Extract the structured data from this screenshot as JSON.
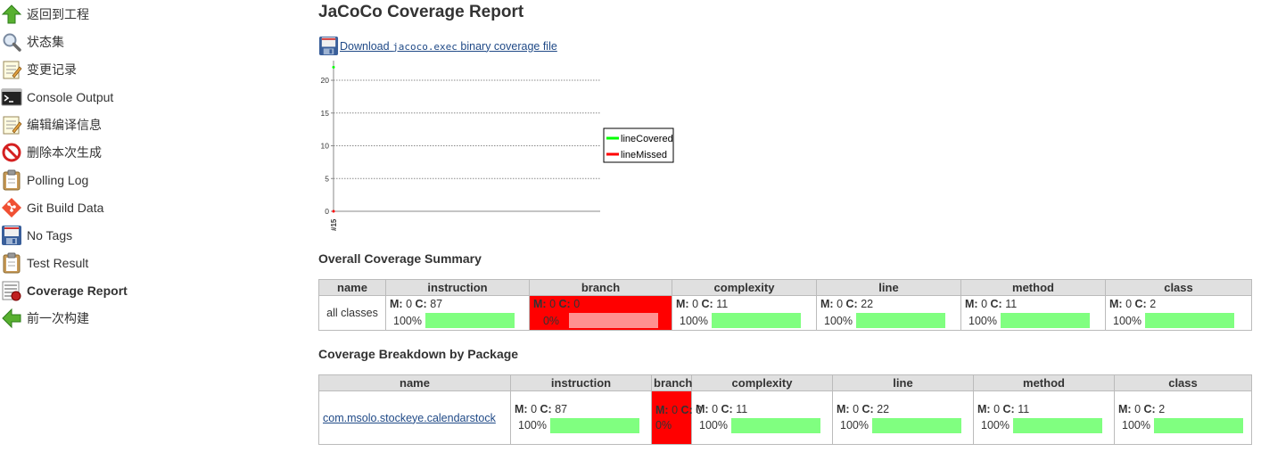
{
  "sidebar": {
    "items": [
      {
        "label": "返回到工程",
        "icon": "up-arrow-icon"
      },
      {
        "label": "状态集",
        "icon": "search-icon"
      },
      {
        "label": "变更记录",
        "icon": "notepad-icon"
      },
      {
        "label": "Console Output",
        "icon": "terminal-icon"
      },
      {
        "label": "编辑编译信息",
        "icon": "notepad-icon"
      },
      {
        "label": "删除本次生成",
        "icon": "no-entry-icon"
      },
      {
        "label": "Polling Log",
        "icon": "clipboard-icon"
      },
      {
        "label": "Git Build Data",
        "icon": "git-icon"
      },
      {
        "label": "No Tags",
        "icon": "floppy-icon"
      },
      {
        "label": "Test Result",
        "icon": "clipboard-icon"
      },
      {
        "label": "Coverage Report",
        "icon": "coverage-report-icon"
      },
      {
        "label": "前一次构建",
        "icon": "left-arrow-icon"
      }
    ],
    "active_index": 10
  },
  "main": {
    "title": "JaCoCo Coverage Report",
    "download": {
      "prefix": "Download ",
      "code": "jacoco.exec",
      "suffix": " binary coverage file"
    }
  },
  "chart_data": {
    "type": "line",
    "x": [
      "#15"
    ],
    "series": [
      {
        "name": "lineCovered",
        "color": "#00ff00",
        "values": [
          22
        ]
      },
      {
        "name": "lineMissed",
        "color": "#ff0000",
        "values": [
          0
        ]
      }
    ],
    "yticks": [
      0,
      5,
      10,
      15,
      20
    ],
    "ylim": [
      0,
      23
    ],
    "grid": true,
    "legend": "right"
  },
  "summary": {
    "title": "Overall Coverage Summary",
    "headers": [
      "name",
      "instruction",
      "branch",
      "complexity",
      "line",
      "method",
      "class"
    ],
    "row": {
      "name": "all classes",
      "cells": [
        {
          "m": "0",
          "c": "87",
          "pct": "100%",
          "ratio": 1
        },
        {
          "m": "0",
          "c": "0",
          "pct": "0%",
          "ratio": 0
        },
        {
          "m": "0",
          "c": "11",
          "pct": "100%",
          "ratio": 1
        },
        {
          "m": "0",
          "c": "22",
          "pct": "100%",
          "ratio": 1
        },
        {
          "m": "0",
          "c": "11",
          "pct": "100%",
          "ratio": 1
        },
        {
          "m": "0",
          "c": "2",
          "pct": "100%",
          "ratio": 1
        }
      ]
    }
  },
  "breakdown": {
    "title": "Coverage Breakdown by Package",
    "headers": [
      "name",
      "instruction",
      "branch",
      "complexity",
      "line",
      "method",
      "class"
    ],
    "rows": [
      {
        "name": "com.msolo.stockeye.calendarstock",
        "cells": [
          {
            "m": "0",
            "c": "87",
            "pct": "100%",
            "ratio": 1
          },
          {
            "m": "0",
            "c": "0",
            "pct": "0%",
            "ratio": 0
          },
          {
            "m": "0",
            "c": "11",
            "pct": "100%",
            "ratio": 1
          },
          {
            "m": "0",
            "c": "22",
            "pct": "100%",
            "ratio": 1
          },
          {
            "m": "0",
            "c": "11",
            "pct": "100%",
            "ratio": 1
          },
          {
            "m": "0",
            "c": "2",
            "pct": "100%",
            "ratio": 1
          }
        ]
      }
    ]
  },
  "labels": {
    "m": "M:",
    "c": "C:"
  }
}
